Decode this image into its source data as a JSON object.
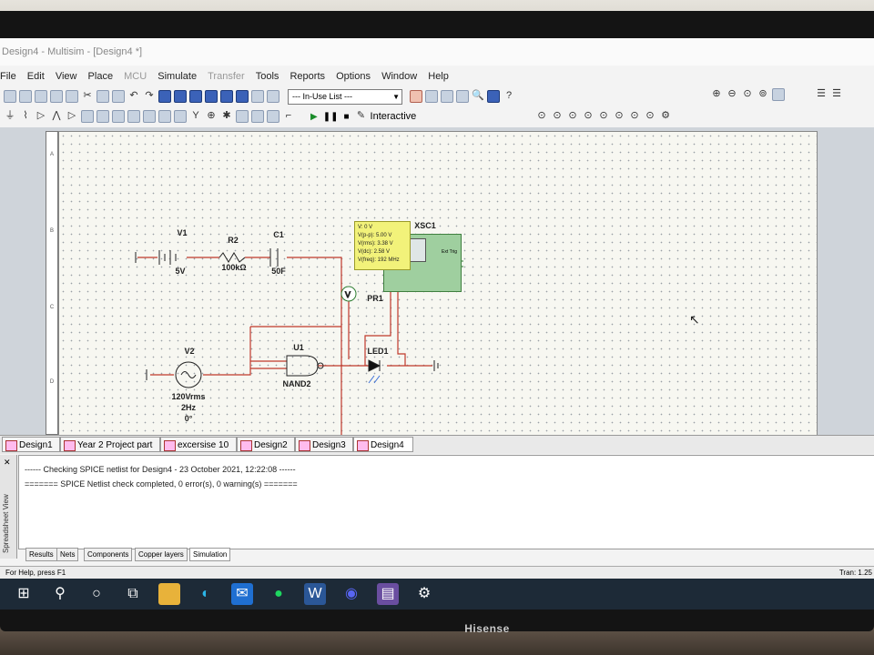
{
  "window": {
    "title": "Design4 - Multisim - [Design4 *]"
  },
  "menu": [
    "File",
    "Edit",
    "View",
    "Place",
    "MCU",
    "Simulate",
    "Transfer",
    "Tools",
    "Reports",
    "Options",
    "Window",
    "Help"
  ],
  "toolbar": {
    "in_use_list": "--- In-Use List ---",
    "interactive_label": "Interactive"
  },
  "schematic": {
    "components": {
      "v1": {
        "ref": "V1",
        "value": "5V"
      },
      "r2": {
        "ref": "R2",
        "value": "100kΩ"
      },
      "c1": {
        "ref": "C1",
        "value": "50F"
      },
      "v2": {
        "ref": "V2",
        "value": "120Vrms",
        "freq": "2Hz",
        "phase": "0°"
      },
      "u1": {
        "ref": "U1",
        "value": "NAND2"
      },
      "led1": {
        "ref": "LED1"
      },
      "pr1": {
        "ref": "PR1"
      },
      "xsc1": {
        "ref": "XSC1",
        "trig": "Ext Trig"
      }
    },
    "probe": {
      "v": "V: 0 V",
      "vpp": "V(p-p): 5.00 V",
      "vrms": "V(rms): 3.38 V",
      "vdc": "V(dc): 2.58 V",
      "vfreq": "V(freq): 192 MHz"
    },
    "border_rows": [
      "A",
      "B",
      "C",
      "D"
    ]
  },
  "design_tabs": [
    "Design1 *",
    "Year 2 Project part A",
    "excersise 10 *",
    "Design2 *",
    "Design3 *",
    "Design4 *"
  ],
  "output": {
    "line1": "------ Checking SPICE netlist for Design4 - 23 October 2021, 12:22:08 ------",
    "line2": "======= SPICE Netlist check completed, 0 error(s), 0 warning(s) ======="
  },
  "spreadsheet_label": "Spreadsheet View",
  "bottom_tabs": [
    "Results",
    "Nets",
    "Components",
    "Copper layers",
    "Simulation"
  ],
  "status": {
    "help": "For Help, press F1",
    "tran": "Tran: 1.25"
  },
  "monitor_brand": "Hisense"
}
